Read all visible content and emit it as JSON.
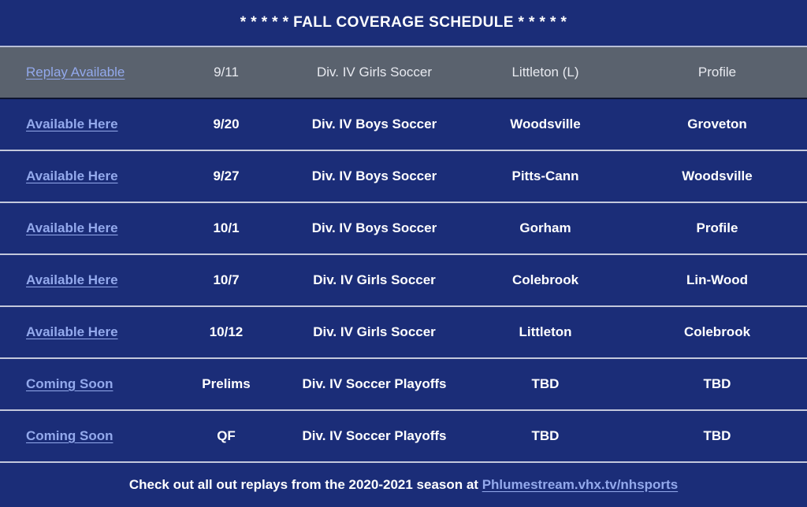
{
  "header": {
    "title": "* * * * * FALL COVERAGE SCHEDULE * * * * *"
  },
  "colors": {
    "background_navy": "#1b2d78",
    "highlight_row_gray": "#5a626e",
    "link_blue": "#93a9ec",
    "text_white": "#ffffff",
    "row_divider": "#c3c8dc"
  },
  "table": {
    "rows": [
      {
        "link_label": "Replay Available",
        "date": "9/11",
        "event": "Div. IV Girls Soccer",
        "team_home": "Littleton (L)",
        "team_away": "Profile",
        "highlighted": true
      },
      {
        "link_label": "Available Here",
        "date": "9/20",
        "event": "Div. IV Boys Soccer",
        "team_home": "Woodsville",
        "team_away": "Groveton",
        "highlighted": false
      },
      {
        "link_label": "Available Here",
        "date": "9/27",
        "event": "Div. IV Boys Soccer",
        "team_home": "Pitts-Cann",
        "team_away": "Woodsville",
        "highlighted": false
      },
      {
        "link_label": "Available Here",
        "date": "10/1",
        "event": "Div. IV Boys Soccer",
        "team_home": "Gorham",
        "team_away": "Profile",
        "highlighted": false
      },
      {
        "link_label": "Available Here",
        "date": "10/7",
        "event": "Div. IV Girls Soccer",
        "team_home": "Colebrook",
        "team_away": "Lin-Wood",
        "highlighted": false
      },
      {
        "link_label": "Available Here",
        "date": "10/12",
        "event": "Div. IV Girls Soccer",
        "team_home": "Littleton",
        "team_away": "Colebrook",
        "highlighted": false
      },
      {
        "link_label": "Coming Soon",
        "date": "Prelims",
        "event": "Div. IV Soccer Playoffs",
        "team_home": "TBD",
        "team_away": "TBD",
        "highlighted": false
      },
      {
        "link_label": "Coming Soon",
        "date": "QF",
        "event": "Div. IV Soccer Playoffs",
        "team_home": "TBD",
        "team_away": "TBD",
        "highlighted": false
      }
    ]
  },
  "footer": {
    "text_before_link": "Check out all out replays from the 2020-2021 season at ",
    "link_label": "Phlumestream.vhx.tv/nhsports"
  }
}
